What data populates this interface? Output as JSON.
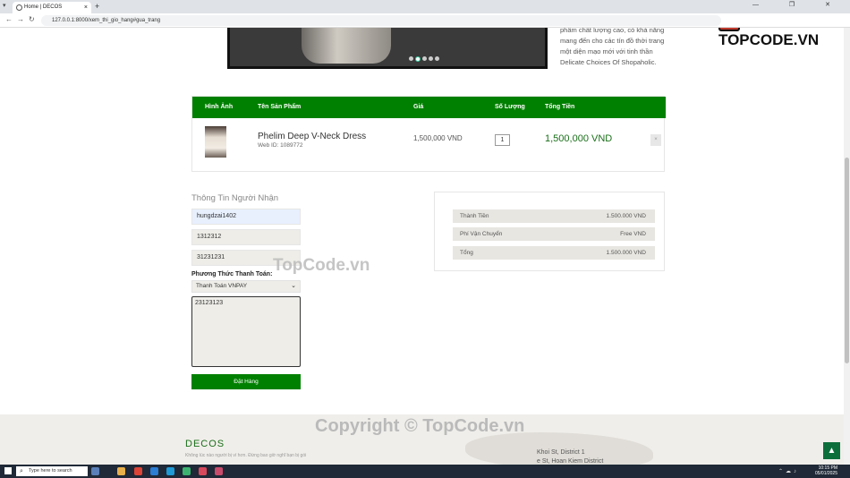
{
  "browser": {
    "tab_title": "Home | DECOS",
    "url": "127.0.0.1:8000/xem_thi_gio_hang#gua_trang",
    "new_tab": "+",
    "tab_close": "×",
    "win_controls": "—  ❐  ✕"
  },
  "brand": {
    "logo_text": "TOPCODE.VN"
  },
  "hero": {
    "side_text": "phẩm chất lượng cao, có khả năng mang đến cho các tín đồ thời trang một diện mạo mới với tinh thần Delicate Choices Of Shopaholic."
  },
  "cart": {
    "headers": [
      "Hình Ảnh",
      "Tên Sản Phẩm",
      "Giá",
      "Số Lượng",
      "Tổng Tiền"
    ],
    "item": {
      "name": "Phelim Deep V-Neck Dress",
      "web_id": "Web ID: 1089772",
      "price": "1,500,000 VND",
      "quantity": "1",
      "total": "1,500,000 VND",
      "remove": "×"
    }
  },
  "form": {
    "title": "Thông Tin Người Nhận",
    "name": "hungdzai1402",
    "phone": "1312312",
    "address": "31231231",
    "payment_label": "Phương Thức Thanh Toán:",
    "payment_value": "Thanh Toán VNPAY",
    "note": "23123123",
    "submit": "Đặt Hàng"
  },
  "summary": {
    "rows": [
      {
        "label": "Thành Tiền",
        "value": "1.500.000 VND"
      },
      {
        "label": "Phí Vận Chuyển",
        "value": "Free VND"
      },
      {
        "label": "Tổng",
        "value": "1.500.000 VND"
      }
    ]
  },
  "footer": {
    "title": "DECOS",
    "desc": "Không lúc nào người bị ví hơn. Đừng bao giờ nghĩ bạn bị gói",
    "address_1": "Khoi St, District 1",
    "address_2": "e St, Hoan Kiem District"
  },
  "watermarks": {
    "center": "TopCode.vn",
    "bottom": "Copyright © TopCode.vn"
  },
  "taskbar": {
    "search_placeholder": "Type here to search",
    "time": "10:15 PM",
    "date": "05/01/2025"
  }
}
